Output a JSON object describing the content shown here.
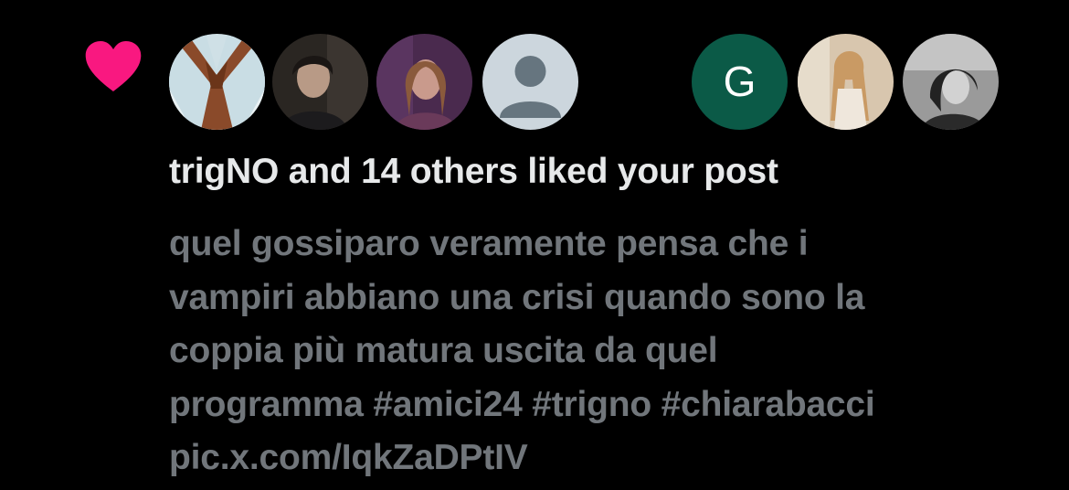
{
  "notification": {
    "type_icon": "heart-icon",
    "heart_color": "#f91880",
    "avatars": [
      {
        "kind": "photo",
        "icon": "avatar-photo"
      },
      {
        "kind": "photo",
        "icon": "avatar-photo"
      },
      {
        "kind": "photo",
        "icon": "avatar-photo"
      },
      {
        "kind": "default",
        "icon": "default-avatar-icon"
      },
      {
        "kind": "letter",
        "letter": "G",
        "color": "#0b5a47"
      },
      {
        "kind": "photo",
        "icon": "avatar-photo"
      },
      {
        "kind": "photo",
        "icon": "avatar-photo"
      }
    ],
    "headline": "trigNO and 14 others liked your post",
    "post_lines": [
      "quel gossiparo veramente pensa che i",
      "vampiri abbiano una crisi quando sono la",
      "coppia più matura uscita da quel",
      "programma #amici24 #trigno #chiarabacci",
      "pic.x.com/IqkZaDPtIV"
    ],
    "colors": {
      "background": "#000000",
      "primary_text": "#e7e9ea",
      "secondary_text": "#71767b"
    }
  }
}
